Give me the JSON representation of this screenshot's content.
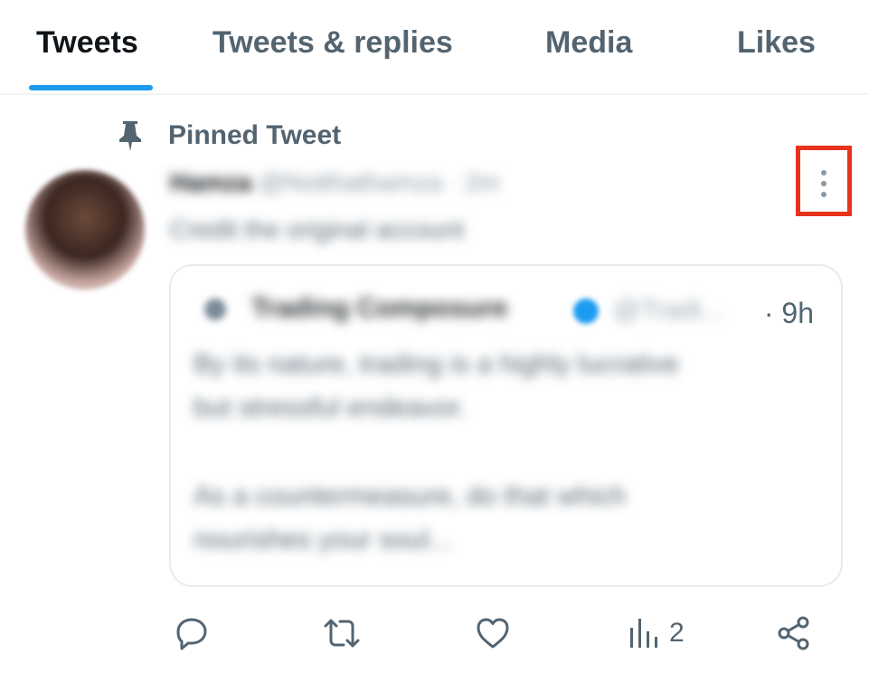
{
  "tabs": [
    {
      "label": "Tweets",
      "active": true
    },
    {
      "label": "Tweets & replies",
      "active": false
    },
    {
      "label": "Media",
      "active": false
    },
    {
      "label": "Likes",
      "active": false
    }
  ],
  "pinned": {
    "label": "Pinned Tweet",
    "icon": "pin-icon"
  },
  "tweet": {
    "author_name": "Hamza",
    "author_meta": "@Notthathamza · 2m",
    "text": "Credit the original account",
    "more_icon": "more-vertical-icon",
    "highlight_color": "#e8331c"
  },
  "quote": {
    "name": "Trading Composure",
    "handle": "@Tradi...",
    "time": "· 9h",
    "lines": [
      "By its nature, trading is a highly lucrative",
      "but stressful endeavor.",
      "As a countermeasure, do that which",
      "nourishes your soul..."
    ]
  },
  "actions": {
    "reply_icon": "reply-icon",
    "retweet_icon": "retweet-icon",
    "like_icon": "like-icon",
    "views_icon": "views-icon",
    "views_count": "2",
    "share_icon": "share-icon"
  },
  "colors": {
    "accent": "#1d9bf0",
    "muted": "#536471",
    "text": "#0f1419"
  }
}
